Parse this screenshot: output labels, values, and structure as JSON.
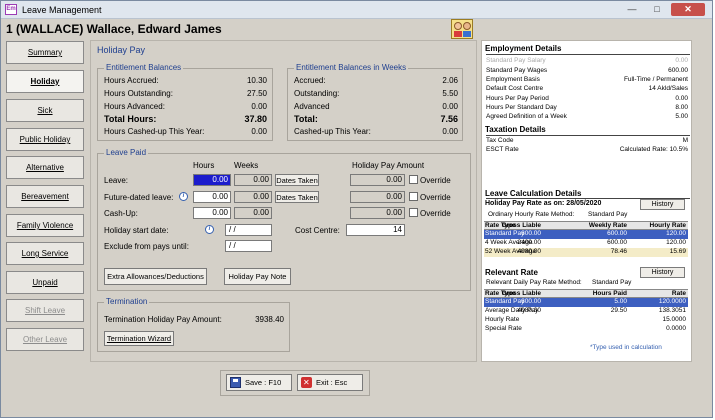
{
  "window": {
    "title": "Leave Management",
    "icon_text": "Em"
  },
  "header": {
    "employee": "1 (WALLACE) Wallace, Edward James"
  },
  "nav": [
    {
      "label": "Summary",
      "state": "normal"
    },
    {
      "label": "Holiday",
      "state": "active"
    },
    {
      "label": "Sick",
      "state": "normal"
    },
    {
      "label": "Public Holiday",
      "state": "normal"
    },
    {
      "label": "Alternative",
      "state": "normal"
    },
    {
      "label": "Bereavement",
      "state": "normal"
    },
    {
      "label": "Family Violence",
      "state": "normal"
    },
    {
      "label": "Long Service",
      "state": "normal"
    },
    {
      "label": "Unpaid",
      "state": "normal"
    },
    {
      "label": "Shift Leave",
      "state": "disabled"
    },
    {
      "label": "Other Leave",
      "state": "disabled"
    }
  ],
  "holiday_pay": {
    "title": "Holiday Pay",
    "balances": {
      "title": "Entitlement Balances",
      "rows": [
        {
          "label": "Hours Accrued:",
          "value": "10.30"
        },
        {
          "label": "Hours Outstanding:",
          "value": "27.50"
        },
        {
          "label": "Hours Advanced:",
          "value": "0.00"
        },
        {
          "label": "Total Hours:",
          "value": "37.80"
        },
        {
          "label": "Hours Cashed-up This Year:",
          "value": "0.00"
        }
      ]
    },
    "weeks": {
      "title": "Entitlement Balances in Weeks",
      "rows": [
        {
          "label": "Accrued:",
          "value": "2.06"
        },
        {
          "label": "Outstanding:",
          "value": "5.50"
        },
        {
          "label": "Advanced",
          "value": "0.00"
        },
        {
          "label": "Total:",
          "value": "7.56"
        },
        {
          "label": "Cashed-up This Year:",
          "value": "0.00"
        }
      ]
    },
    "leave_paid": {
      "title": "Leave Paid",
      "col_hours": "Hours",
      "col_weeks": "Weeks",
      "col_amount": "Holiday Pay Amount",
      "rows": [
        {
          "label": "Leave:",
          "hours": "0.00",
          "weeks": "0.00",
          "button": "Dates Taken",
          "amount": "0.00",
          "override": "Override"
        },
        {
          "label": "Future-dated leave:",
          "hours": "0.00",
          "weeks": "0.00",
          "button": "Dates Taken",
          "amount": "0.00",
          "override": "Override"
        },
        {
          "label": "Cash-Up:",
          "hours": "0.00",
          "weeks": "0.00",
          "amount": "0.00",
          "override": "Override"
        }
      ],
      "holiday_start_label": "Holiday start date:",
      "holiday_start_value": "/ /",
      "exclude_label": "Exclude from pays until:",
      "exclude_value": "/ /",
      "cost_centre_label": "Cost Centre:",
      "cost_centre_value": "14",
      "extra_button": "Extra Allowances/Deductions",
      "note_button": "Holiday Pay Note"
    },
    "termination": {
      "title": "Termination",
      "amount_label": "Termination Holiday Pay Amount:",
      "amount_value": "3938.40",
      "wizard_button": "Termination Wizard"
    }
  },
  "employment": {
    "title": "Employment Details",
    "rows": [
      {
        "k": "Standard Pay Salary",
        "v": "0.00",
        "muted": true
      },
      {
        "k": "Standard Pay Wages",
        "v": "600.00"
      },
      {
        "k": "Employment Basis",
        "v": "Full-Time / Permanent"
      },
      {
        "k": "Default Cost Centre",
        "v": "14 Akld/Sales"
      },
      {
        "k": "Hours Per Pay Period",
        "v": "0.00"
      },
      {
        "k": "Hours Per Standard Day",
        "v": "8.00"
      },
      {
        "k": "Agreed Definition of a Week",
        "v": "5.00"
      }
    ]
  },
  "taxation": {
    "title": "Taxation Details",
    "rows": [
      {
        "k": "Tax Code",
        "v": "M"
      },
      {
        "k": "ESCT Rate",
        "v": "Calculated Rate: 10.5%"
      }
    ]
  },
  "leave_calc": {
    "title": "Leave Calculation Details",
    "rate_as_on": "Holiday Pay Rate as on: 28/05/2020",
    "history_button": "History",
    "method_label": "Ordinary Hourly Rate Method:",
    "method_value": "Standard Pay",
    "table1": {
      "headers": [
        "Rate Type",
        "Gross Liable",
        "Weekly Rate",
        "Hourly Rate"
      ],
      "rows": [
        [
          "Standard Pay",
          "600.00",
          "600.00",
          "120.00"
        ],
        [
          "4 Week Average",
          "2400.00",
          "600.00",
          "120.00"
        ],
        [
          "52 Week Average",
          "4080.00",
          "78.46",
          "15.69"
        ]
      ]
    },
    "relevant_title": "Relevant Rate",
    "relevant_history_button": "History",
    "relevant_method_label": "Relevant Daily Pay Rate Method:",
    "relevant_method_value": "Standard Pay",
    "table2": {
      "headers": [
        "Rate Type",
        "Gross Liable",
        "Hours Paid",
        "Rate"
      ],
      "rows": [
        [
          "Standard Pay",
          "600.00",
          "5.00",
          "120.0000"
        ],
        [
          "Average Daily Pay",
          "4080.00",
          "29.50",
          "138.3051"
        ],
        [
          "Hourly Rate",
          "",
          "",
          "15.0000"
        ],
        [
          "Special Rate",
          "",
          "",
          "0.0000"
        ]
      ]
    },
    "note": "*Type used in calculation"
  },
  "footer": {
    "save": "Save : F10",
    "exit": "Exit : Esc"
  }
}
